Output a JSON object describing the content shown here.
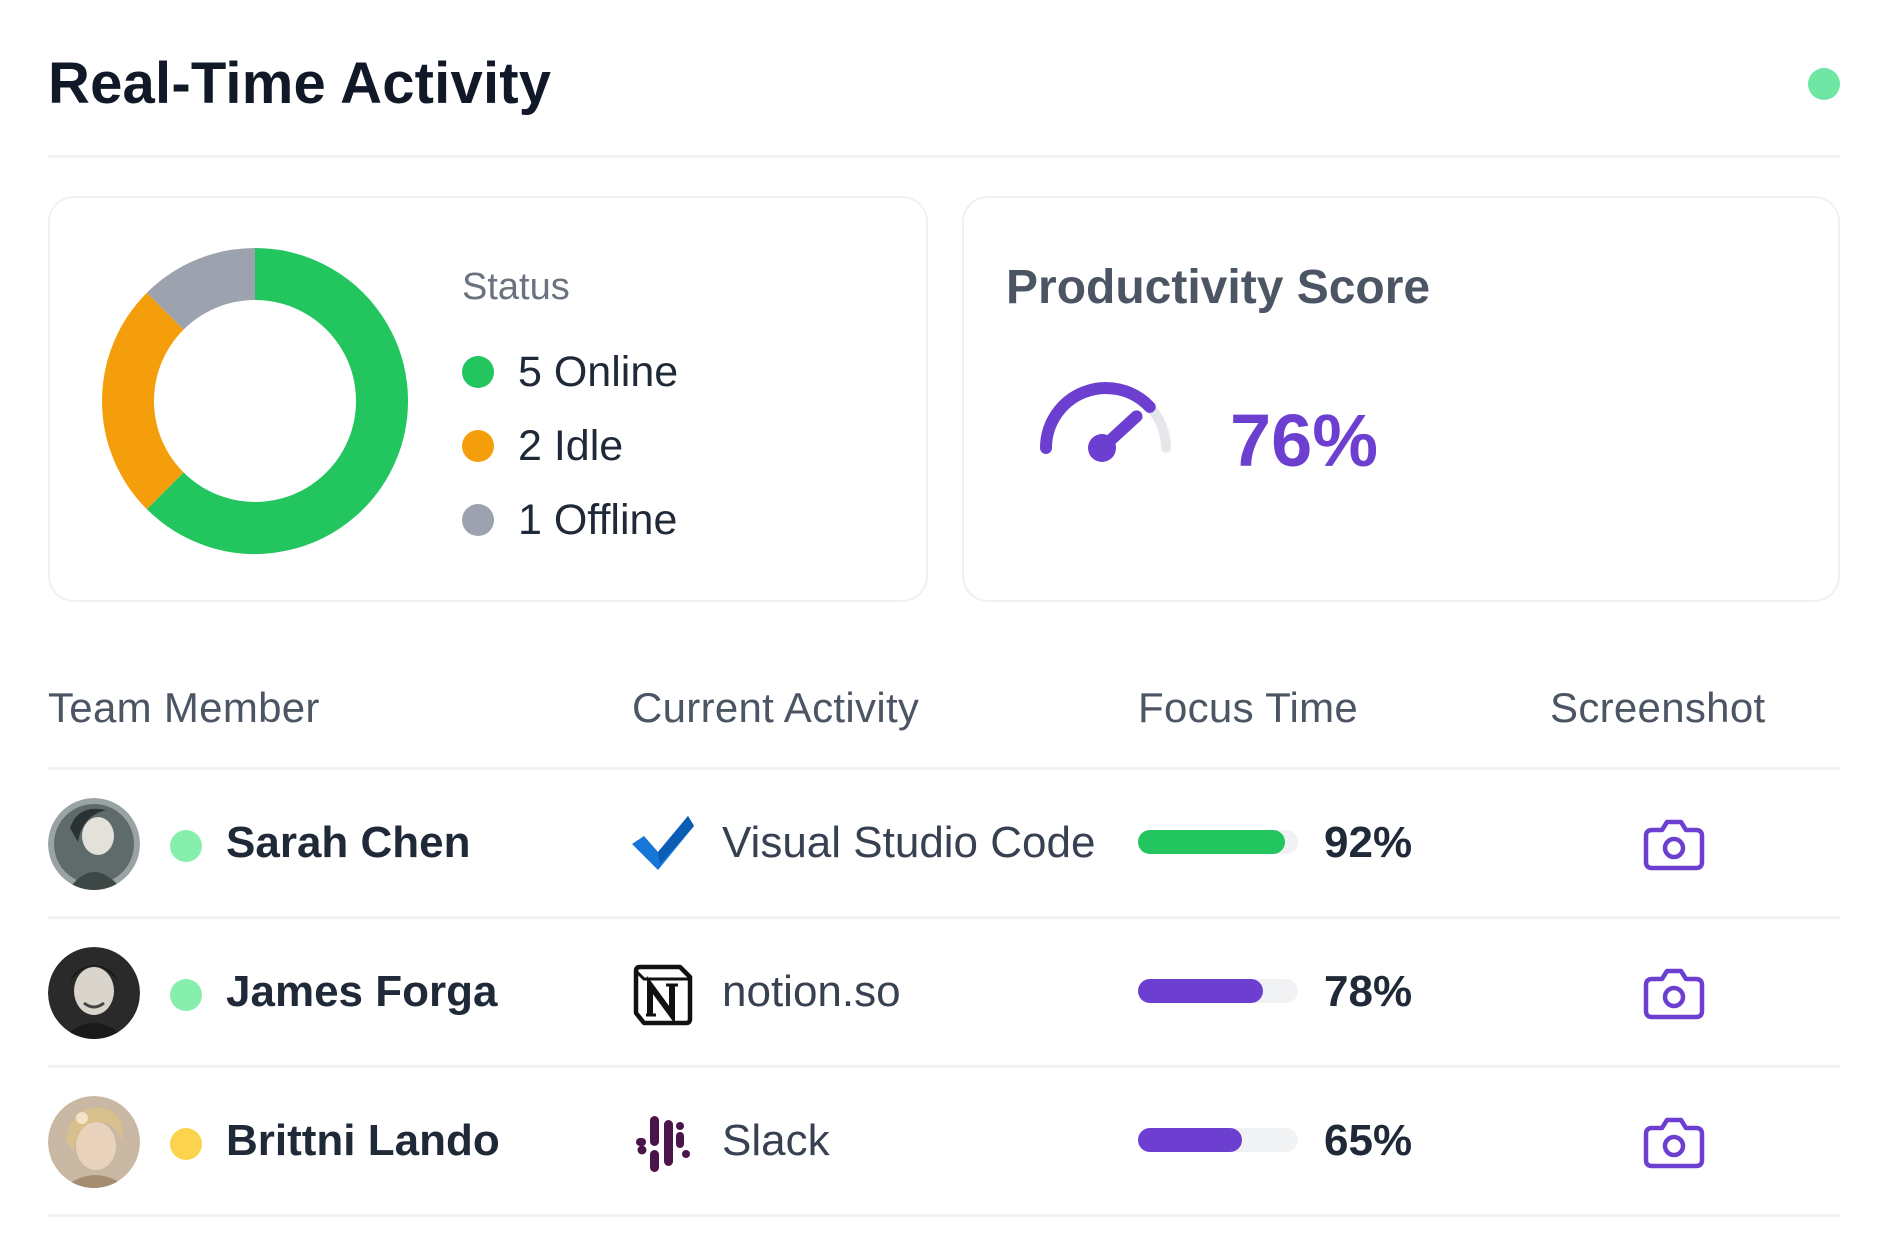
{
  "header": {
    "title": "Real-Time Activity",
    "live_color": "#6ee7a4"
  },
  "status_card": {
    "title": "Status",
    "items": [
      {
        "count": 5,
        "label": "5 Online",
        "color": "#22c55e"
      },
      {
        "count": 2,
        "label": "2 Idle",
        "color": "#f59e0b"
      },
      {
        "count": 1,
        "label": "1 Offline",
        "color": "#9ca3af"
      }
    ]
  },
  "productivity": {
    "title": "Productivity Score",
    "value": "76%",
    "score": 76,
    "color": "#6d3fd1"
  },
  "table": {
    "headers": [
      "Team Member",
      "Current Activity",
      "Focus Time",
      "Screenshot"
    ],
    "rows": [
      {
        "name": "Sarah Chen",
        "status_color": "#86efac",
        "app": "Visual Studio Code",
        "app_icon": "vscode-icon",
        "focus": 92,
        "focus_label": "92%",
        "bar_color": "#22c55e",
        "action_icon": "camera-icon"
      },
      {
        "name": "James Forga",
        "status_color": "#86efac",
        "app": "notion.so",
        "app_icon": "notion-icon",
        "focus": 78,
        "focus_label": "78%",
        "bar_color": "#6d3fd1",
        "action_icon": "camera-icon"
      },
      {
        "name": "Brittni Lando",
        "status_color": "#fcd34d",
        "app": "Slack",
        "app_icon": "slack-icon",
        "focus": 65,
        "focus_label": "65%",
        "bar_color": "#6d3fd1",
        "action_icon": "camera-icon"
      }
    ]
  },
  "colors": {
    "accent": "#6d3fd1",
    "online": "#22c55e",
    "idle": "#f59e0b",
    "offline": "#9ca3af"
  }
}
